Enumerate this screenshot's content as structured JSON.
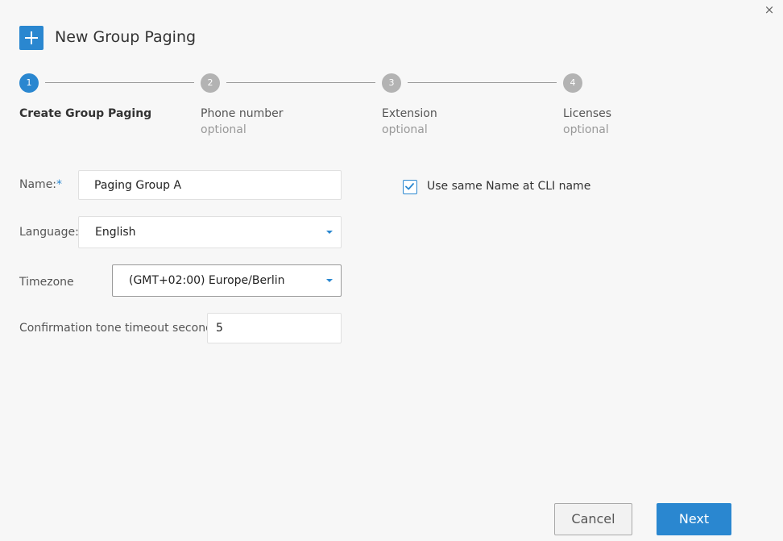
{
  "dialog": {
    "title": "New Group Paging",
    "close_glyph": "×",
    "title_icon": "plus-icon",
    "accent_color": "#2a87d0"
  },
  "steps": [
    {
      "number": "1",
      "label": "Create Group Paging",
      "sub": "",
      "active": true
    },
    {
      "number": "2",
      "label": "Phone number",
      "sub": "optional",
      "active": false
    },
    {
      "number": "3",
      "label": "Extension",
      "sub": "optional",
      "active": false
    },
    {
      "number": "4",
      "label": "Licenses",
      "sub": "optional",
      "active": false
    }
  ],
  "form": {
    "name": {
      "label": "Name:",
      "required_mark": "*",
      "value": "Paging Group A"
    },
    "language": {
      "label": "Language:",
      "value": "English"
    },
    "timezone": {
      "label": "Timezone",
      "value": "(GMT+02:00) Europe/Berlin"
    },
    "confirmation": {
      "label": "Confirmation tone timeout seconds",
      "value": "5"
    },
    "same_name": {
      "label": "Use same Name at CLI name",
      "checked": true
    }
  },
  "buttons": {
    "cancel": "Cancel",
    "next": "Next"
  }
}
